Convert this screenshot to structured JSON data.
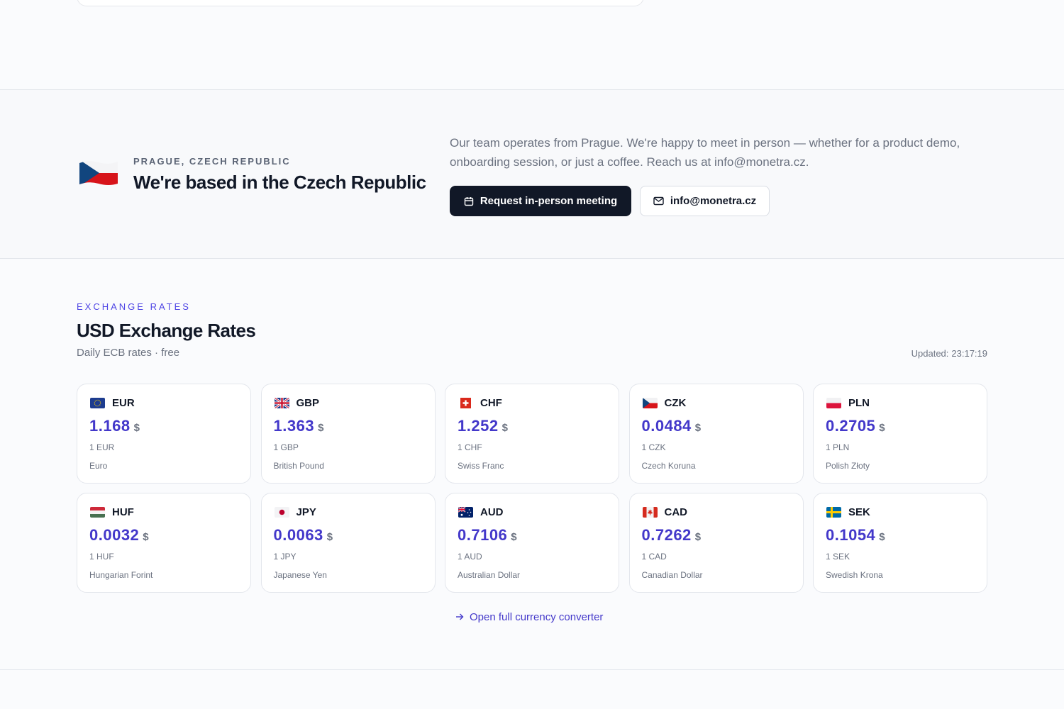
{
  "prague": {
    "eyebrow": "PRAGUE, CZECH REPUBLIC",
    "title": "We're based in the Czech Republic",
    "description": "Our team operates from Prague. We're happy to meet in person — whether for a product demo, onboarding session, or just a coffee. Reach us at info@monetra.cz.",
    "primary_button": "Request in-person meeting",
    "secondary_button": "info@monetra.cz",
    "flag_icon": "czech-flag-icon"
  },
  "rates": {
    "eyebrow": "EXCHANGE RATES",
    "title": "USD Exchange Rates",
    "subtitle": "Daily ECB rates · free",
    "updated_label": "Updated:",
    "updated_time": "23:17:19",
    "currency_symbol": "$",
    "accent_color": "#4338ca",
    "cards": [
      {
        "code": "EUR",
        "rate": "1.168",
        "unit": "1 EUR",
        "name": "Euro",
        "flag": "eu-flag-icon"
      },
      {
        "code": "GBP",
        "rate": "1.363",
        "unit": "1 GBP",
        "name": "British Pound",
        "flag": "uk-flag-icon"
      },
      {
        "code": "CHF",
        "rate": "1.252",
        "unit": "1 CHF",
        "name": "Swiss Franc",
        "flag": "swiss-flag-icon"
      },
      {
        "code": "CZK",
        "rate": "0.0484",
        "unit": "1 CZK",
        "name": "Czech Koruna",
        "flag": "czech-flag-icon"
      },
      {
        "code": "PLN",
        "rate": "0.2705",
        "unit": "1 PLN",
        "name": "Polish Złoty",
        "flag": "poland-flag-icon"
      },
      {
        "code": "HUF",
        "rate": "0.0032",
        "unit": "1 HUF",
        "name": "Hungarian Forint",
        "flag": "hungary-flag-icon"
      },
      {
        "code": "JPY",
        "rate": "0.0063",
        "unit": "1 JPY",
        "name": "Japanese Yen",
        "flag": "japan-flag-icon"
      },
      {
        "code": "AUD",
        "rate": "0.7106",
        "unit": "1 AUD",
        "name": "Australian Dollar",
        "flag": "australia-flag-icon"
      },
      {
        "code": "CAD",
        "rate": "0.7262",
        "unit": "1 CAD",
        "name": "Canadian Dollar",
        "flag": "canada-flag-icon"
      },
      {
        "code": "SEK",
        "rate": "0.1054",
        "unit": "1 SEK",
        "name": "Swedish Krona",
        "flag": "sweden-flag-icon"
      }
    ],
    "converter_link": "Open full currency converter"
  }
}
